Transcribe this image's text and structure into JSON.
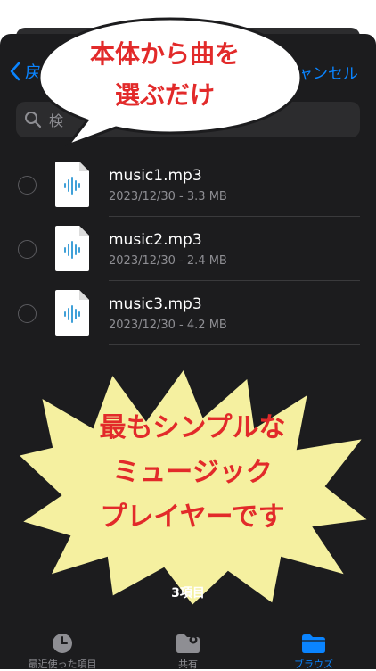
{
  "nav": {
    "back_label": "戻",
    "cancel_label": "ャンセル"
  },
  "search": {
    "placeholder": "検"
  },
  "files": [
    {
      "name": "music1.mp3",
      "meta": "2023/12/30 - 3.3 MB"
    },
    {
      "name": "music2.mp3",
      "meta": "2023/12/30 - 2.4 MB"
    },
    {
      "name": "music3.mp3",
      "meta": "2023/12/30 - 4.2 MB"
    }
  ],
  "bubble": {
    "line1": "本体から曲を",
    "line2": "選ぶだけ"
  },
  "burst": {
    "line1": "最もシンプルな",
    "line2": "ミュージック",
    "line3": "プレイヤーです"
  },
  "footer": {
    "count": "3項目"
  },
  "tabs": [
    {
      "label": "最近使った項目",
      "icon": "clock-icon",
      "active": false
    },
    {
      "label": "共有",
      "icon": "shared-folder-icon",
      "active": false
    },
    {
      "label": "ブラウズ",
      "icon": "folder-icon",
      "active": true
    }
  ],
  "colors": {
    "accent": "#0a84ff",
    "headline_red": "#e22a2a",
    "burst_fill": "#f5f0a0",
    "waveform_blue": "#3fa0d8"
  }
}
